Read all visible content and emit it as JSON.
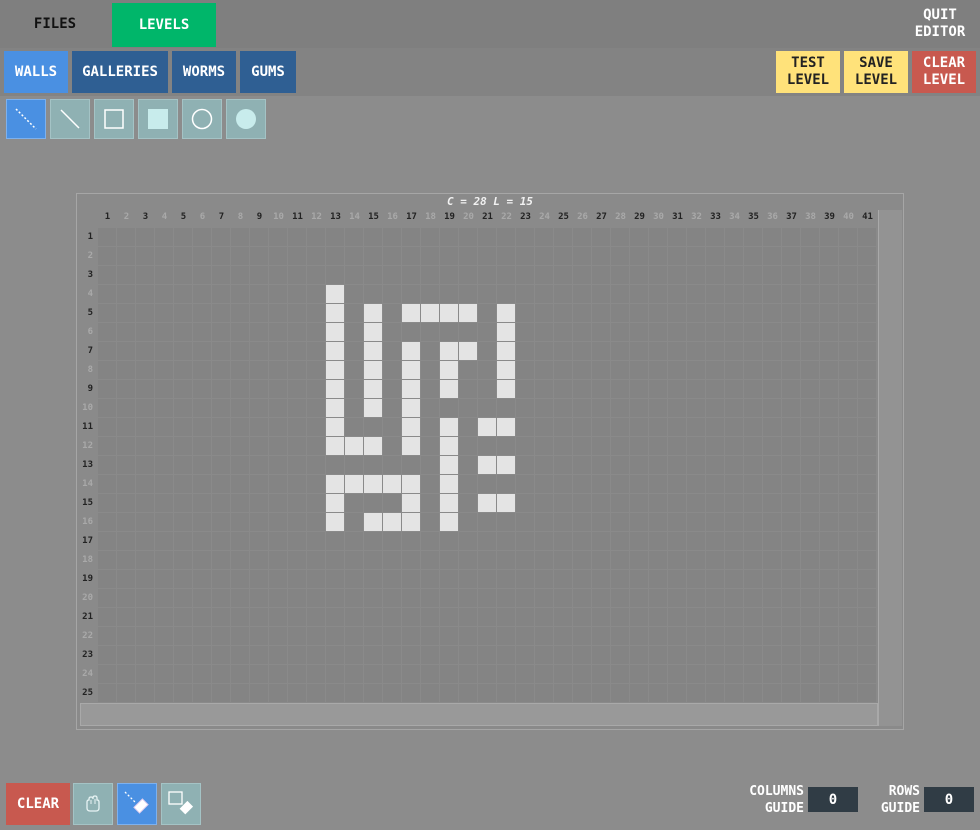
{
  "top": {
    "files": "FILES",
    "levels": "LEVELS",
    "quit": [
      "QUIT",
      "EDITOR"
    ]
  },
  "tabs": [
    "WALLS",
    "GALLERIES",
    "WORMS",
    "GUMS"
  ],
  "actions": {
    "test": [
      "TEST",
      "LEVEL"
    ],
    "save": [
      "SAVE",
      "LEVEL"
    ],
    "clear": [
      "CLEAR",
      "LEVEL"
    ]
  },
  "tools": [
    "dotted-line",
    "line",
    "rectangle",
    "filled-rectangle",
    "circle",
    "filled-circle"
  ],
  "grid": {
    "caption": "C = 28 L = 15",
    "columns": 41,
    "rows": 25,
    "walls": [
      [
        13,
        4
      ],
      [
        13,
        5
      ],
      [
        15,
        5
      ],
      [
        17,
        5
      ],
      [
        18,
        5
      ],
      [
        19,
        5
      ],
      [
        20,
        5
      ],
      [
        22,
        5
      ],
      [
        13,
        6
      ],
      [
        15,
        6
      ],
      [
        22,
        6
      ],
      [
        13,
        7
      ],
      [
        15,
        7
      ],
      [
        17,
        7
      ],
      [
        19,
        7
      ],
      [
        20,
        7
      ],
      [
        22,
        7
      ],
      [
        13,
        8
      ],
      [
        15,
        8
      ],
      [
        17,
        8
      ],
      [
        19,
        8
      ],
      [
        22,
        8
      ],
      [
        13,
        9
      ],
      [
        15,
        9
      ],
      [
        17,
        9
      ],
      [
        19,
        9
      ],
      [
        22,
        9
      ],
      [
        13,
        10
      ],
      [
        15,
        10
      ],
      [
        17,
        10
      ],
      [
        13,
        11
      ],
      [
        17,
        11
      ],
      [
        19,
        11
      ],
      [
        21,
        11
      ],
      [
        22,
        11
      ],
      [
        13,
        12
      ],
      [
        14,
        12
      ],
      [
        15,
        12
      ],
      [
        17,
        12
      ],
      [
        19,
        12
      ],
      [
        19,
        13
      ],
      [
        21,
        13
      ],
      [
        22,
        13
      ],
      [
        13,
        14
      ],
      [
        14,
        14
      ],
      [
        15,
        14
      ],
      [
        16,
        14
      ],
      [
        17,
        14
      ],
      [
        19,
        14
      ],
      [
        13,
        15
      ],
      [
        17,
        15
      ],
      [
        19,
        15
      ],
      [
        21,
        15
      ],
      [
        22,
        15
      ],
      [
        13,
        16
      ],
      [
        15,
        16
      ],
      [
        16,
        16
      ],
      [
        17,
        16
      ],
      [
        19,
        16
      ]
    ]
  },
  "bottom": {
    "clear": "CLEAR",
    "columns_guide": [
      "COLUMNS",
      "GUIDE"
    ],
    "columns_value": "0",
    "rows_guide": [
      "ROWS",
      "GUIDE"
    ],
    "rows_value": "0"
  },
  "colors": {
    "levels_active": "#00b66a",
    "tab_active": "#4a90e2",
    "tab": "#2f5f93",
    "yellow": "#ffe27a",
    "red": "#c8594f",
    "wall": "#e4e4e4"
  }
}
